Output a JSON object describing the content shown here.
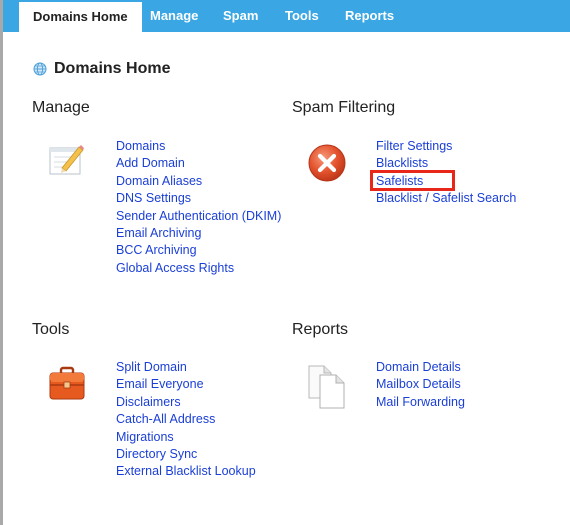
{
  "tabs": [
    {
      "label": "Domains Home",
      "active": true
    },
    {
      "label": "Manage",
      "active": false
    },
    {
      "label": "Spam",
      "active": false
    },
    {
      "label": "Tools",
      "active": false
    },
    {
      "label": "Reports",
      "active": false
    }
  ],
  "page_title": "Domains Home",
  "manage": {
    "heading": "Manage",
    "links": [
      "Domains",
      "Add Domain",
      "Domain Aliases",
      "DNS Settings",
      "Sender Authentication (DKIM)",
      "Email Archiving",
      "BCC Archiving",
      "Global Access Rights"
    ]
  },
  "spam": {
    "heading": "Spam Filtering",
    "links": [
      "Filter Settings",
      "Blacklists",
      "Safelists",
      "Blacklist / Safelist Search"
    ]
  },
  "tools": {
    "heading": "Tools",
    "links": [
      "Split Domain",
      "Email Everyone",
      "Disclaimers",
      "Catch-All Address",
      "Migrations",
      "Directory Sync",
      "External Blacklist Lookup"
    ]
  },
  "reports": {
    "heading": "Reports",
    "links": [
      "Domain Details",
      "Mailbox Details",
      "Mail Forwarding"
    ]
  },
  "colors": {
    "tabbar": "#3aa6e3",
    "link": "#1a3fd6",
    "highlight": "#e8261a"
  },
  "icons": {
    "title": "globe-icon",
    "manage": "notepad-pencil-icon",
    "spam": "red-x-circle-icon",
    "tools": "toolbox-icon",
    "reports": "documents-icon"
  }
}
